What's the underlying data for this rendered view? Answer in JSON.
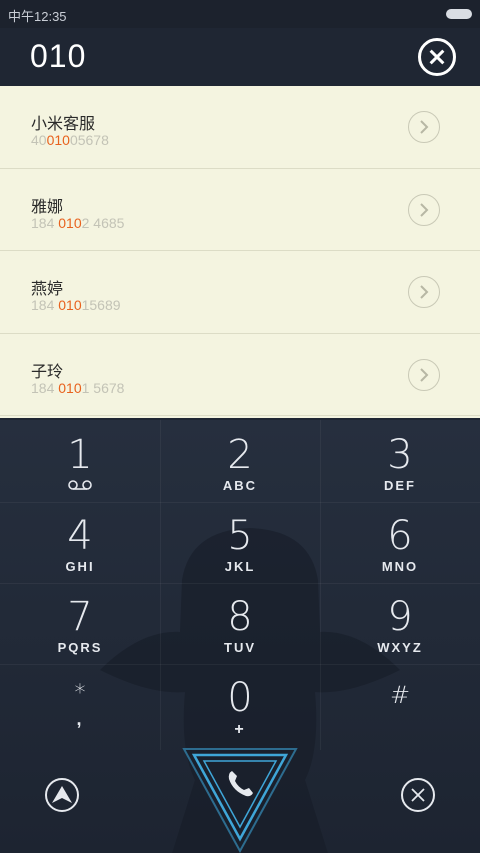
{
  "status_bar": {
    "time": "中午12:35"
  },
  "dial": {
    "number": "010"
  },
  "results": [
    {
      "name": "小米客服",
      "phone_pre": "40",
      "phone_hl": "010",
      "phone_post": "05678"
    },
    {
      "name": "雅娜",
      "phone_pre": "184 ",
      "phone_hl": "010",
      "phone_post": "2 4685"
    },
    {
      "name": "燕婷",
      "phone_pre": "184 ",
      "phone_hl": "010",
      "phone_post": "15689"
    },
    {
      "name": "子玲",
      "phone_pre": "184 ",
      "phone_hl": "010",
      "phone_post": "1 5678"
    }
  ],
  "keypad": {
    "keys": [
      {
        "digit": "1",
        "letters": ""
      },
      {
        "digit": "2",
        "letters": "ABC"
      },
      {
        "digit": "3",
        "letters": "DEF"
      },
      {
        "digit": "4",
        "letters": "GHI"
      },
      {
        "digit": "5",
        "letters": "JKL"
      },
      {
        "digit": "6",
        "letters": "MNO"
      },
      {
        "digit": "7",
        "letters": "PQRS"
      },
      {
        "digit": "8",
        "letters": "TUV"
      },
      {
        "digit": "9",
        "letters": "WXYZ"
      },
      {
        "digit": "*",
        "letters": ","
      },
      {
        "digit": "0",
        "letters": "+"
      },
      {
        "digit": "#",
        "letters": ""
      }
    ]
  },
  "colors": {
    "highlight": "#e8621e",
    "results_bg": "#f4f4e0",
    "call_accent": "#3fa6d8"
  },
  "icons": {
    "clear": "close-circle-icon",
    "detail": "chevron-right-icon",
    "voicemail": "voicemail-icon",
    "contacts": "up-arrow-icon",
    "call": "phone-handset-icon",
    "hide_keypad": "x-circle-icon"
  }
}
